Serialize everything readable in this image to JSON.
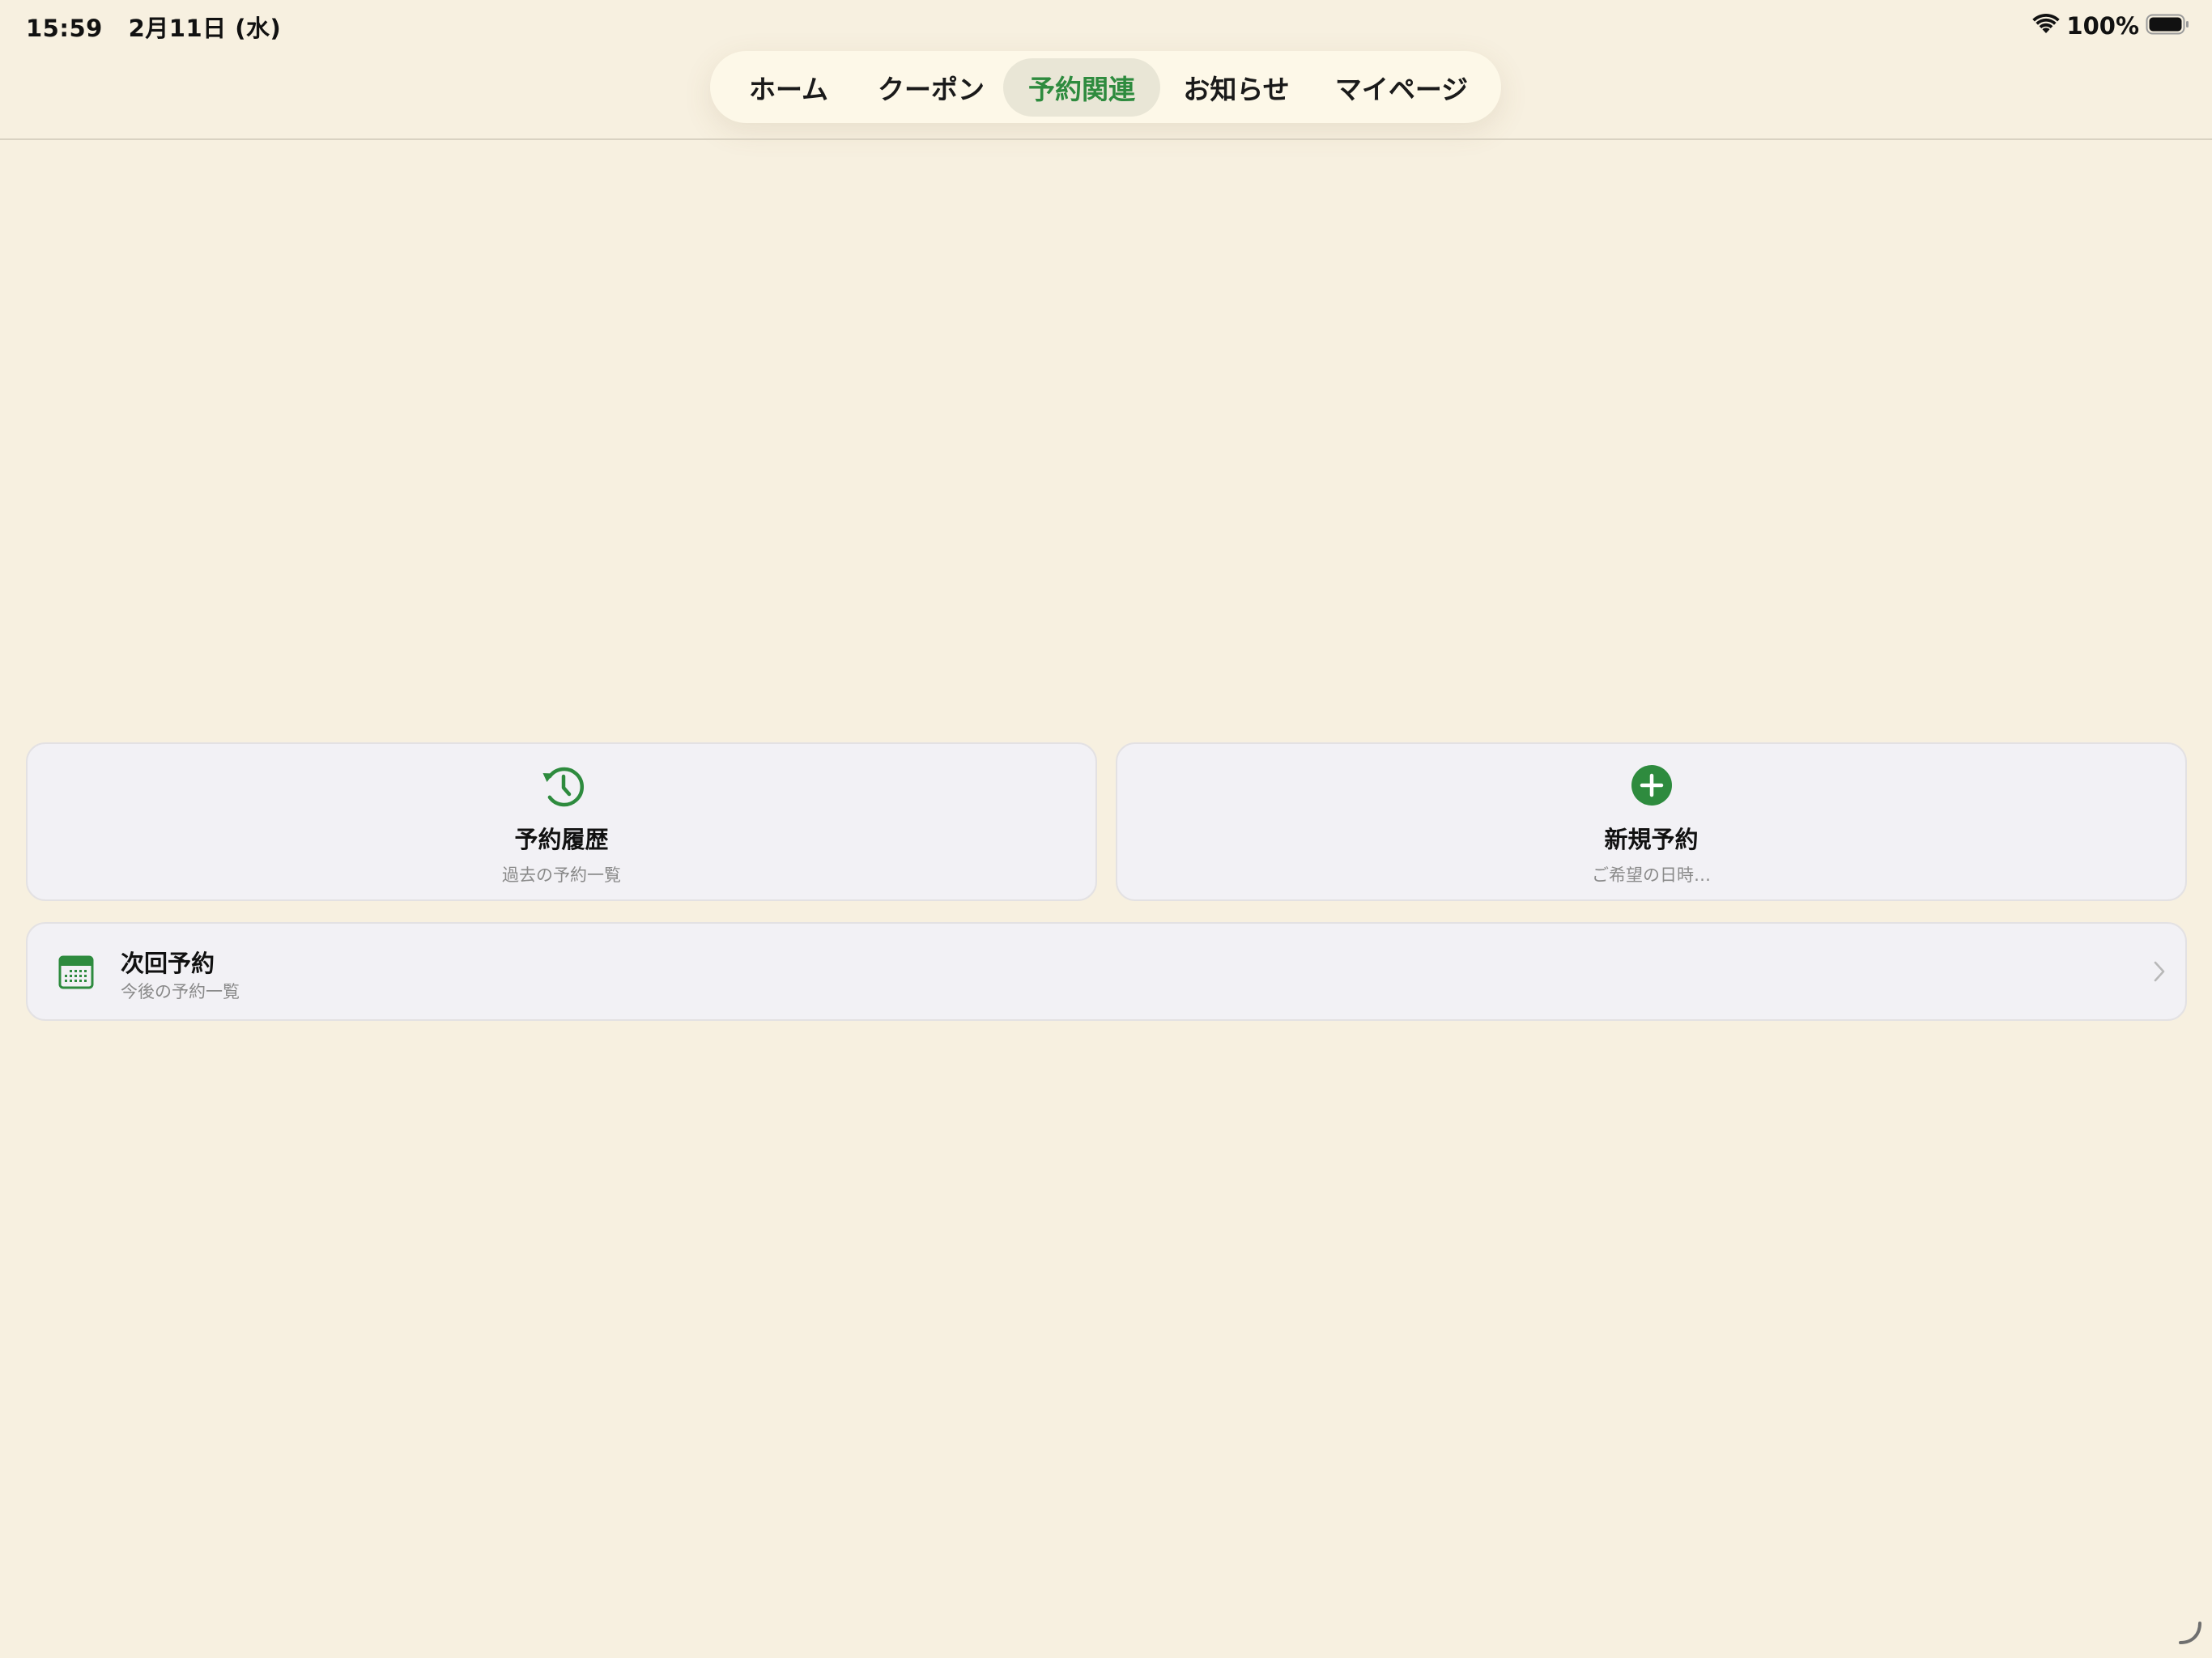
{
  "status_bar": {
    "time": "15:59",
    "date": "2月11日 (水)",
    "battery": "100%",
    "icons": [
      "wifi-icon",
      "battery-icon"
    ]
  },
  "nav": {
    "tabs": [
      {
        "label": "ホーム",
        "active": false
      },
      {
        "label": "クーポン",
        "active": false
      },
      {
        "label": "予約関連",
        "active": true
      },
      {
        "label": "お知らせ",
        "active": false
      },
      {
        "label": "マイページ",
        "active": false
      }
    ]
  },
  "cards": {
    "history": {
      "title": "予約履歴",
      "subtitle": "過去の予約一覧",
      "icon": "history-clock-icon"
    },
    "new": {
      "title": "新規予約",
      "subtitle": "ご希望の日時…",
      "icon": "plus-circle-icon"
    }
  },
  "next_reservation": {
    "title": "次回予約",
    "subtitle": "今後の予約一覧",
    "icon": "calendar-icon"
  },
  "colors": {
    "background": "#F7F0E0",
    "accent": "#2E8B3E",
    "card": "#F2F1F5",
    "nav_pill": "#FDF8E8",
    "nav_active": "#E9E6D6"
  }
}
